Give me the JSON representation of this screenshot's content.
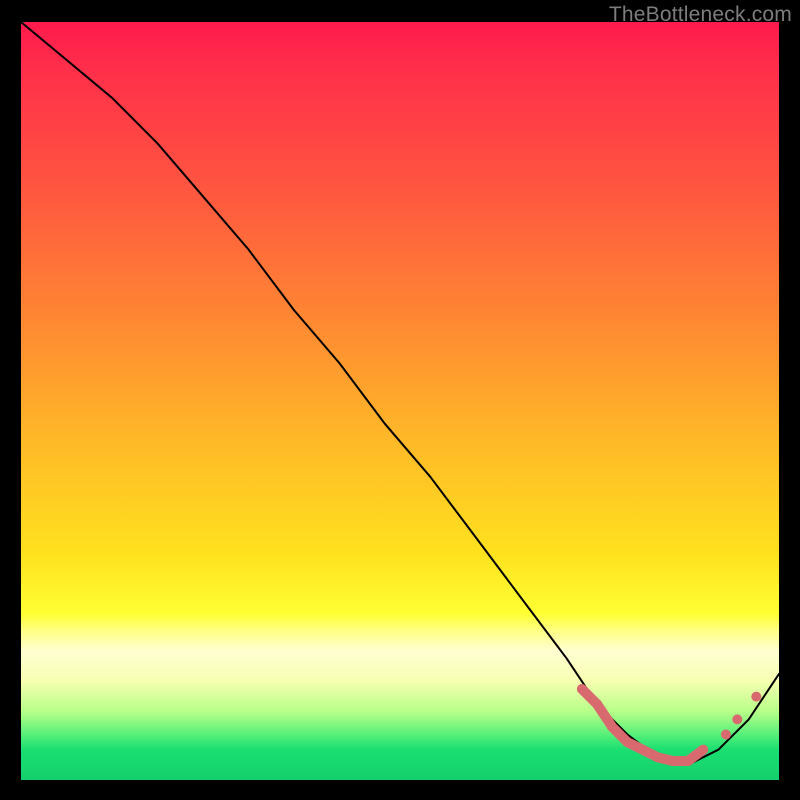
{
  "watermark": "TheBottleneck.com",
  "chart_data": {
    "type": "line",
    "title": "",
    "xlabel": "",
    "ylabel": "",
    "xlim": [
      0,
      100
    ],
    "ylim": [
      0,
      100
    ],
    "series": [
      {
        "name": "bottleneck-curve",
        "x": [
          0,
          6,
          12,
          18,
          24,
          30,
          36,
          42,
          48,
          54,
          60,
          66,
          72,
          76,
          80,
          84,
          88,
          92,
          96,
          100
        ],
        "y": [
          100,
          95,
          90,
          84,
          77,
          70,
          62,
          55,
          47,
          40,
          32,
          24,
          16,
          10,
          6,
          3,
          2,
          4,
          8,
          14
        ],
        "color": "#000000"
      }
    ],
    "markers": {
      "name": "highlighted-points",
      "indices_dense_segment": {
        "x_start": 74,
        "x_end": 90
      },
      "points": [
        {
          "x": 74,
          "y": 12
        },
        {
          "x": 76,
          "y": 10
        },
        {
          "x": 78,
          "y": 7
        },
        {
          "x": 80,
          "y": 5
        },
        {
          "x": 82,
          "y": 4
        },
        {
          "x": 84,
          "y": 3
        },
        {
          "x": 86,
          "y": 2.5
        },
        {
          "x": 88,
          "y": 2.5
        },
        {
          "x": 90,
          "y": 4
        },
        {
          "x": 93,
          "y": 6
        },
        {
          "x": 94.5,
          "y": 8
        },
        {
          "x": 97,
          "y": 11
        }
      ],
      "color": "#d86a6f"
    },
    "background_gradient": {
      "direction": "vertical",
      "stops": [
        {
          "pos": 0.0,
          "color": "#ff1a4d"
        },
        {
          "pos": 0.4,
          "color": "#ff8a32"
        },
        {
          "pos": 0.78,
          "color": "#ffff33"
        },
        {
          "pos": 0.95,
          "color": "#1adf71"
        }
      ]
    }
  }
}
